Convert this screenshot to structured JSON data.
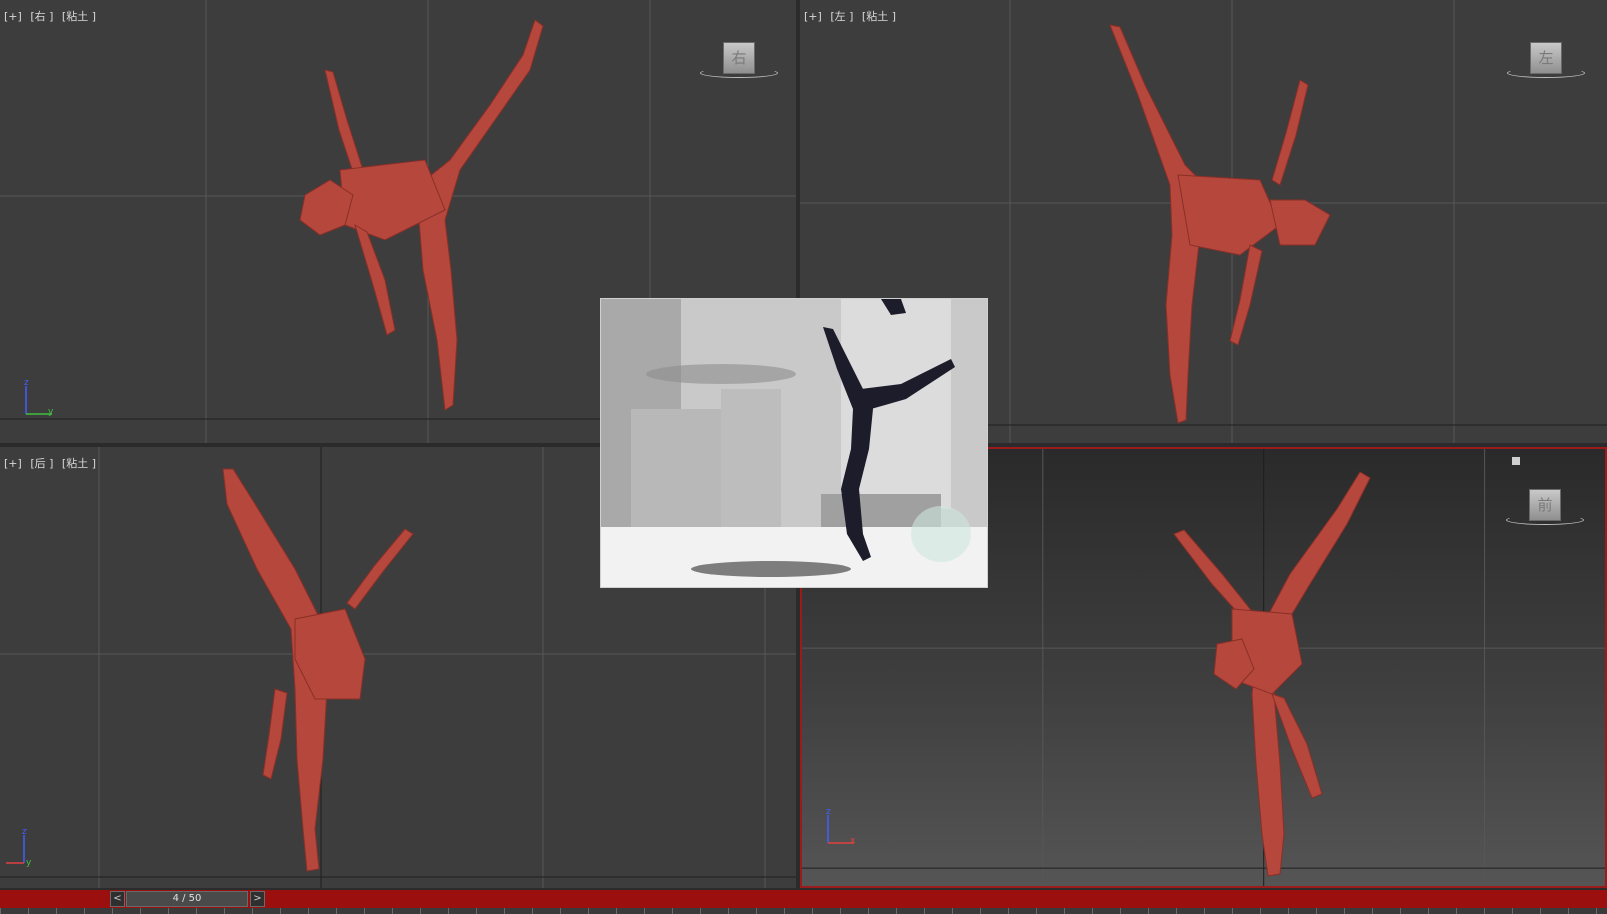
{
  "viewports": {
    "top_left": {
      "plus": "[+]",
      "view": "[右 ]",
      "shading": "[粘土 ]",
      "cube_label": "右"
    },
    "top_right": {
      "plus": "[+]",
      "view": "[左 ]",
      "shading": "[粘土 ]",
      "cube_label": "左"
    },
    "bottom_left": {
      "plus": "[+]",
      "view": "[后 ]",
      "shading": "[粘土 ]"
    },
    "bottom_right": {
      "cube_label": "前"
    }
  },
  "axes": {
    "z": "z",
    "y": "y",
    "x": "x"
  },
  "timeslider": {
    "prev": "<",
    "frame": "4 / 50",
    "next": ">"
  },
  "colors": {
    "model": "#b5473d",
    "viewport_bg": "#3d3d3d",
    "active_border": "#9b1a1a",
    "timebar": "#9b0f0f",
    "axis_x": "#e04040",
    "axis_y": "#40c040",
    "axis_z": "#4060ff"
  }
}
